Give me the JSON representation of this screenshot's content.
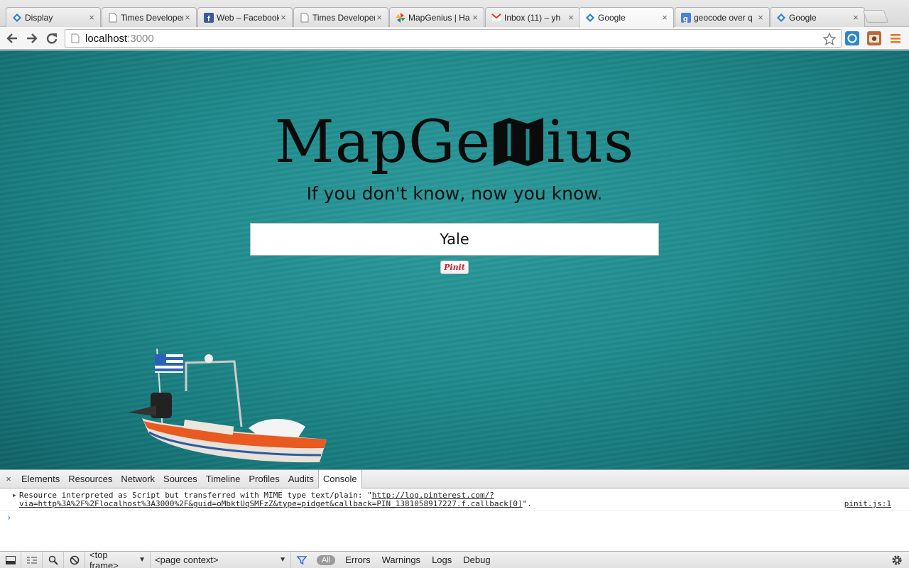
{
  "browser": {
    "tabs": [
      {
        "title": "Display",
        "favicon": "blue-diamond-icon",
        "active": false
      },
      {
        "title": "Times Developer",
        "favicon": "document-icon",
        "active": false
      },
      {
        "title": "Web – Facebook",
        "favicon": "facebook-icon",
        "active": false
      },
      {
        "title": "Times Developer",
        "favicon": "document-icon",
        "active": false
      },
      {
        "title": "MapGenius | Ha",
        "favicon": "mapgenius-pinwheel-icon",
        "active": false
      },
      {
        "title": "Inbox (11) – yh",
        "favicon": "gmail-icon",
        "active": false
      },
      {
        "title": "Google",
        "favicon": "blue-diamond-icon",
        "active": true
      },
      {
        "title": "geocode over q",
        "favicon": "google-g-icon",
        "active": false
      },
      {
        "title": "Google",
        "favicon": "blue-diamond-icon",
        "active": false
      }
    ],
    "close_glyph": "×",
    "address": {
      "host": "localhost",
      "port": ":3000"
    }
  },
  "page": {
    "logo_left": "MapGe",
    "logo_right": "ius",
    "tagline": "If you don't know, now you know.",
    "search_value": "Yale",
    "pinit_label": "Pinit"
  },
  "devtools": {
    "close_glyph": "×",
    "tabs": [
      "Elements",
      "Resources",
      "Network",
      "Sources",
      "Timeline",
      "Profiles",
      "Audits",
      "Console"
    ],
    "active_tab": "Console",
    "console": {
      "message_prefix": "Resource interpreted as Script but transferred with MIME type text/plain: \"",
      "message_link_line1": "http://log.pinterest.com/?",
      "message_link_line2": "via=http%3A%2F%2Flocalhost%3A3000%2F&guid=oMbktUqSMFzZ&type=pidget&callback=PIN_1381058917227.f.callback[0]",
      "message_suffix": "\".",
      "source": "pinit.js:1",
      "prompt": "›"
    },
    "status": {
      "frame_select": "<top frame>",
      "context_select": "<page context>",
      "filter_all": "All",
      "filters": [
        "Errors",
        "Warnings",
        "Logs",
        "Debug"
      ]
    }
  }
}
